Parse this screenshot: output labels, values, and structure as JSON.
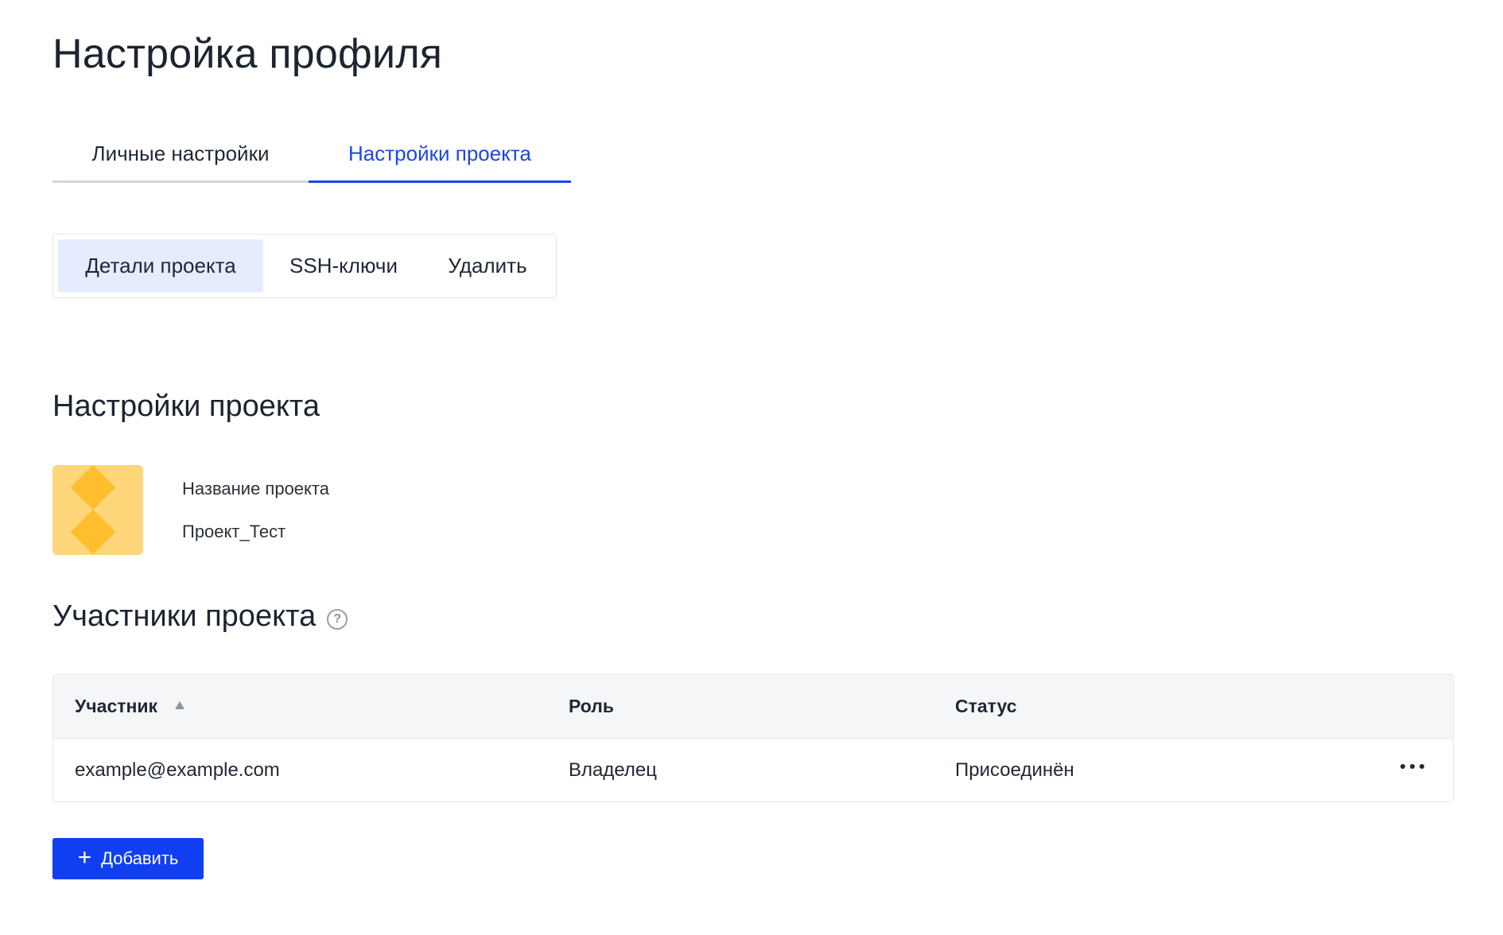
{
  "header": {
    "title": "Настройка профиля"
  },
  "tabs": [
    {
      "label": "Личные настройки",
      "active": false
    },
    {
      "label": "Настройки проекта",
      "active": true
    }
  ],
  "subtabs": [
    {
      "label": "Детали проекта",
      "active": true
    },
    {
      "label": "SSH-ключи",
      "active": false
    },
    {
      "label": "Удалить",
      "active": false
    }
  ],
  "project_settings": {
    "title": "Настройки проекта",
    "name_label": "Название проекта",
    "name_value": "Проект_Тест"
  },
  "members": {
    "title": "Участники проекта",
    "help_icon": "question-circle-icon",
    "columns": [
      "Участник",
      "Роль",
      "Статус"
    ],
    "rows": [
      {
        "member": "example@example.com",
        "role": "Владелец",
        "status": "Присоединён"
      }
    ],
    "add_label": "Добавить"
  },
  "colors": {
    "accent": "#1c46e8",
    "button": "#0f3ff0",
    "active_subtab_bg": "#e4ecfd",
    "avatar_bg": "#ffd67a",
    "avatar_fg": "#ffbe2e"
  }
}
